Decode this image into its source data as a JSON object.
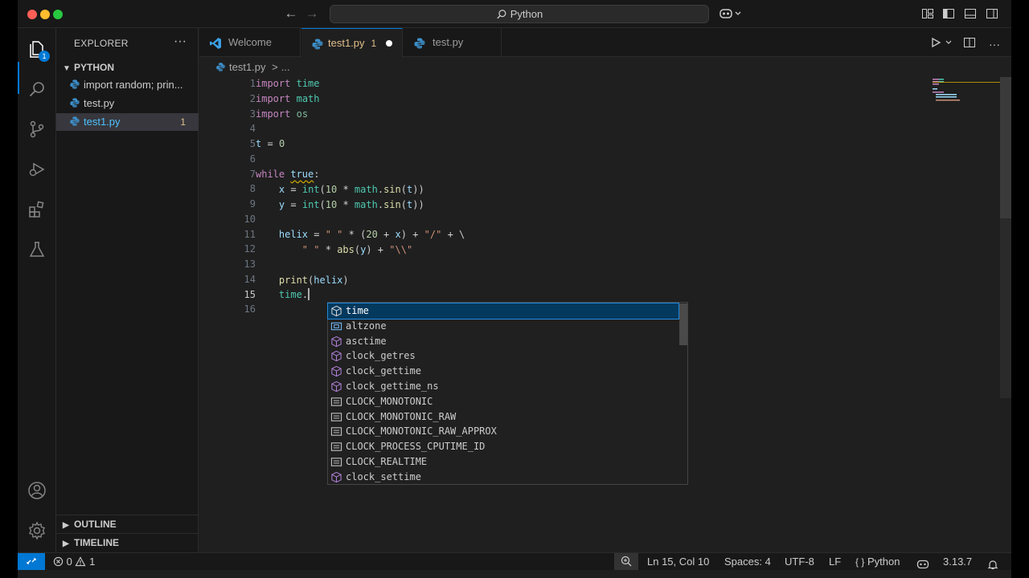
{
  "titlebar": {
    "search_text": "Python"
  },
  "activity": {
    "explorer_badge": "1"
  },
  "sidebar": {
    "title": "EXPLORER",
    "more": "···",
    "folder": "PYTHON",
    "files": [
      {
        "name": "import random; prin..."
      },
      {
        "name": "test.py"
      },
      {
        "name": "test1.py",
        "count": "1"
      }
    ],
    "outline": "OUTLINE",
    "timeline": "TIMELINE"
  },
  "tabs": [
    {
      "label": "Welcome"
    },
    {
      "label": "test1.py",
      "problems": "1"
    },
    {
      "label": "test.py"
    }
  ],
  "breadcrumb": {
    "file": "test1.py",
    "sep": ">",
    "tail": "..."
  },
  "editor": {
    "current_line": 15,
    "line_numbers": [
      "1",
      "2",
      "3",
      "4",
      "5",
      "6",
      "7",
      "8",
      "9",
      "10",
      "11",
      "12",
      "13",
      "14",
      "15",
      "16"
    ]
  },
  "suggest": {
    "items": [
      {
        "label": "time",
        "kind": "module"
      },
      {
        "label": "altzone",
        "kind": "variable"
      },
      {
        "label": "asctime",
        "kind": "function"
      },
      {
        "label": "clock_getres",
        "kind": "function"
      },
      {
        "label": "clock_gettime",
        "kind": "function"
      },
      {
        "label": "clock_gettime_ns",
        "kind": "function"
      },
      {
        "label": "CLOCK_MONOTONIC",
        "kind": "constant"
      },
      {
        "label": "CLOCK_MONOTONIC_RAW",
        "kind": "constant"
      },
      {
        "label": "CLOCK_MONOTONIC_RAW_APPROX",
        "kind": "constant"
      },
      {
        "label": "CLOCK_PROCESS_CPUTIME_ID",
        "kind": "constant"
      },
      {
        "label": "CLOCK_REALTIME",
        "kind": "constant"
      },
      {
        "label": "clock_settime",
        "kind": "function"
      }
    ]
  },
  "statusbar": {
    "errors": "0",
    "warnings": "1",
    "position": "Ln 15, Col 10",
    "spaces": "Spaces: 4",
    "encoding": "UTF-8",
    "eol": "LF",
    "language": "Python",
    "version": "3.13.7"
  },
  "colors": {
    "accent": "#0078d4",
    "modified": "#e2c08d",
    "keyword": "#c586c0",
    "module": "#4ec9b0",
    "function": "#dcdcaa",
    "string": "#ce9178"
  }
}
